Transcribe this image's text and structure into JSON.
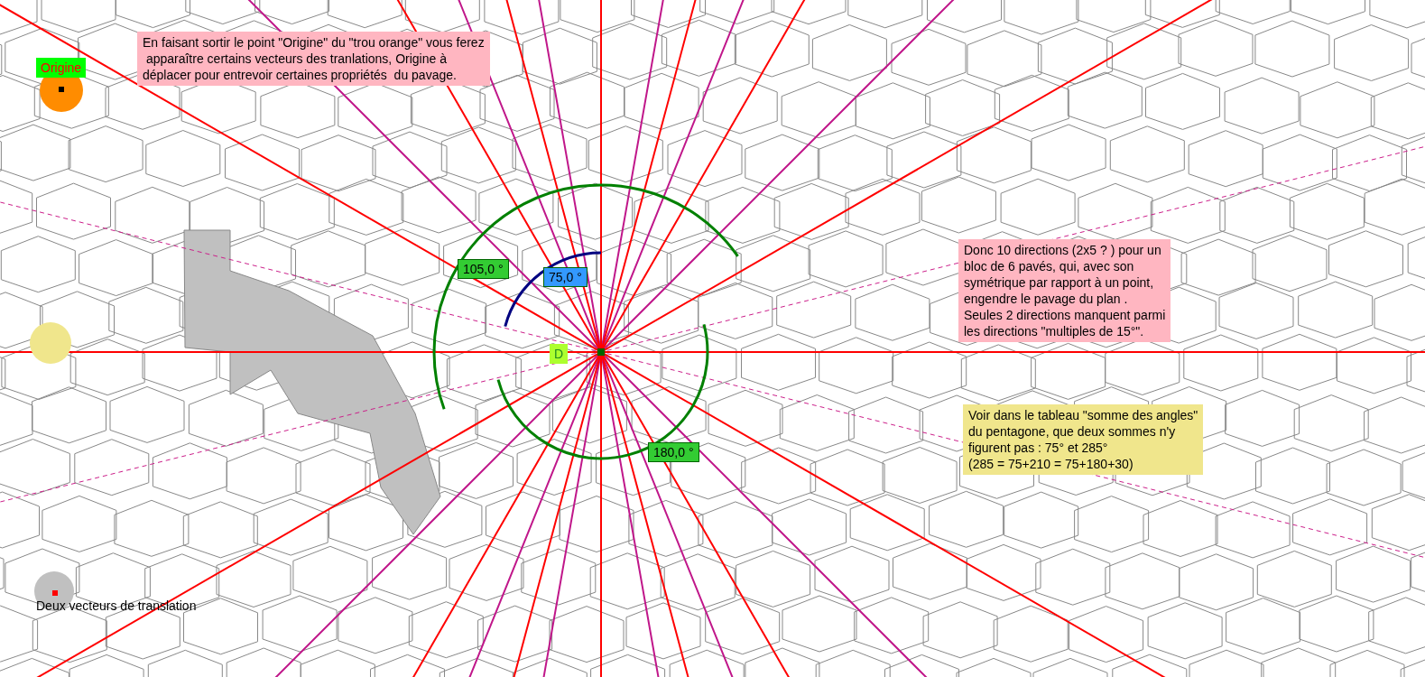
{
  "notes": [
    {
      "text": "En faisant sortir le point \"Origine\" du \"trou orange\" vous ferez\n apparaître certains vecteurs des tranlations, Origine à\ndéplacer pour entrevoir certaines propriétés  du pavage.",
      "color": "#ffb6c1"
    },
    {
      "text": "Donc 10 directions (2x5 ? ) pour un\nbloc de 6 pavés, qui, avec son\nsymétrique par rapport à un point,\nengendre le pavage du plan .\nSeules 2 directions manquent parmi\nles directions \"multiples de 15°\".",
      "color": "#ffb6c1"
    },
    {
      "text": "Voir dans le tableau \"somme des angles\"\ndu pentagone, que deux sommes n'y\nfigurent pas : 75° et 285°\n(285 = 75+210 = 75+180+30)",
      "color": "#f0e68c"
    }
  ],
  "angle_labels": [
    {
      "text": "105,0 °",
      "color": "#33cc33"
    },
    {
      "text": "75,0 °",
      "color": "#3399ff"
    },
    {
      "text": "180,0 °",
      "color": "#33cc33"
    }
  ],
  "point_labels": [
    {
      "text": "Origine",
      "color": "#00ff00"
    },
    {
      "text": "D",
      "color": "#adff2f"
    }
  ],
  "caption": "Deux vecteurs de translation"
}
